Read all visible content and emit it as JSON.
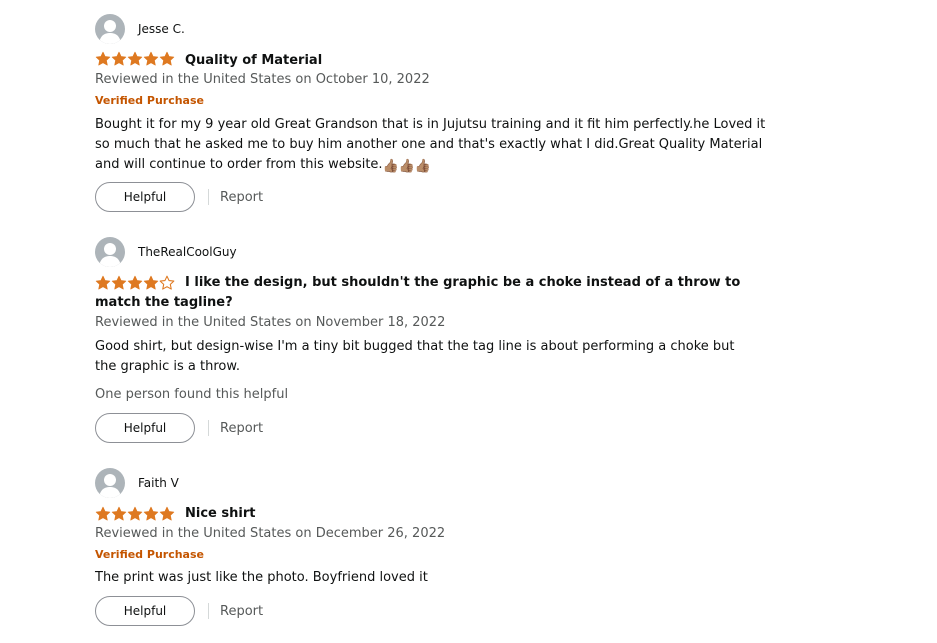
{
  "colors": {
    "star": "#de7921",
    "verified": "#c45500",
    "meta_text": "#565959",
    "text": "#0f1111",
    "avatar": "#adb4b9"
  },
  "reviews": [
    {
      "profile_name": "Jesse C.",
      "rating": 5,
      "title": "Quality of Material",
      "date": "Reviewed in the United States on October 10, 2022",
      "verified": "Verified Purchase",
      "body": "Bought it for my 9 year old Great Grandson that is in Jujutsu training and it fit him perfectly.he Loved it so much that he asked me to buy him another one and that's exactly what I did.Great Quality Material and will continue to order from this website.",
      "emoji": "👍🏽👍🏽👍🏽",
      "helpful_count": "",
      "helpful_label": "Helpful",
      "report_label": "Report"
    },
    {
      "profile_name": "TheRealCoolGuy",
      "rating": 4,
      "title": "I like the design, but shouldn't the graphic be a choke instead of a throw to match the tagline?",
      "date": "Reviewed in the United States on November 18, 2022",
      "verified": "",
      "body": "Good shirt, but design-wise I'm a tiny bit bugged that the tag line is about performing a choke but the graphic is a throw.",
      "emoji": "",
      "helpful_count": "One person found this helpful",
      "helpful_label": "Helpful",
      "report_label": "Report"
    },
    {
      "profile_name": "Faith V",
      "rating": 5,
      "title": "Nice shirt",
      "date": "Reviewed in the United States on December 26, 2022",
      "verified": "Verified Purchase",
      "body": "The print was just like the photo. Boyfriend loved it",
      "emoji": "",
      "helpful_count": "",
      "helpful_label": "Helpful",
      "report_label": "Report"
    }
  ]
}
